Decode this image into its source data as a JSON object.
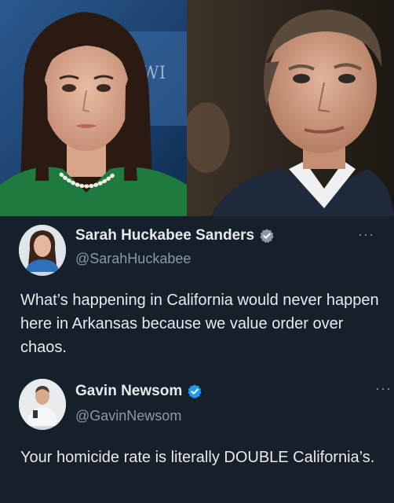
{
  "photos": {
    "left_subject": "woman-portrait",
    "right_subject": "man-portrait"
  },
  "tweets": [
    {
      "display_name": "Sarah Huckabee Sanders",
      "handle": "@SarahHuckabee",
      "verified": true,
      "more_label": "···",
      "text": "What’s happening in California would never happen here in Arkansas because we value order over chaos."
    },
    {
      "display_name": "Gavin Newsom",
      "handle": "@GavinNewsom",
      "verified": true,
      "more_label": "···",
      "text": "Your homicide rate is literally DOUBLE California’s."
    }
  ],
  "colors": {
    "tweet_background": "#15202b",
    "text_primary": "#e7e9ea",
    "text_secondary": "#8b98a5",
    "verified_blue": "#1d9bf0",
    "verified_gray": "#8b98a5"
  }
}
